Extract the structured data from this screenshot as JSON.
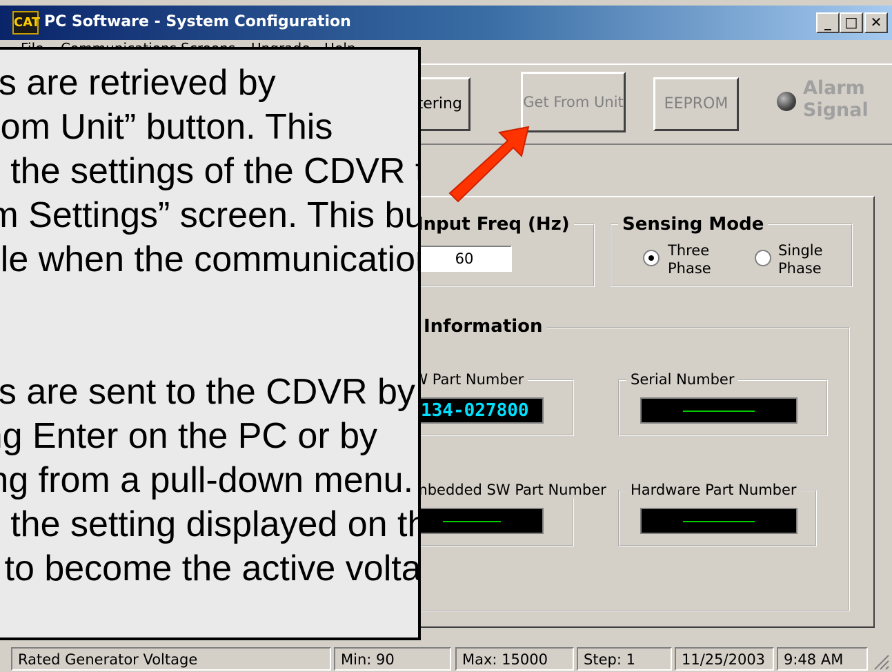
{
  "window": {
    "title": "PC Software - System Configuration",
    "app_icon_text": "CAT",
    "controls": {
      "minimize": "_",
      "maximize": "□",
      "close": "✕"
    }
  },
  "menu": {
    "items": [
      "File",
      "Communications",
      "Screens",
      "Upgrade",
      "Help"
    ]
  },
  "toolbar": {
    "metering_label": "Metering",
    "get_from_unit_label": "Get From Unit",
    "eeprom_label": "EEPROM",
    "alarm_label_1": "Alarm",
    "alarm_label_2": "Signal"
  },
  "config": {
    "input_freq": {
      "label": "Input Freq (Hz)",
      "value": "60"
    },
    "sensing_mode": {
      "label": "Sensing Mode",
      "options": [
        {
          "line1": "Three",
          "line2": "Phase",
          "selected": true
        },
        {
          "line1": "Single",
          "line2": "Phase",
          "selected": false
        }
      ]
    },
    "information": {
      "label": "Information",
      "sw_part_number": {
        "label": "SW Part Number",
        "value": "134-027800"
      },
      "serial_number": {
        "label": "Serial Number",
        "value": ""
      },
      "embedded_sw_part_number": {
        "label": "Embedded SW Part Number",
        "value": ""
      },
      "hardware_part_number": {
        "label": "Hardware Part Number",
        "value": ""
      }
    }
  },
  "status": {
    "parameter": "Rated Generator Voltage",
    "min": "Min: 90",
    "max": "Max: 15000",
    "step": "Step: 1",
    "date": "11/25/2003",
    "time": "9:48 AM"
  },
  "overlay": {
    "lines_1": [
      "Settings are retrieved by",
      "“Get From Unit” button. This",
      "causes the settings of the CDVR to be",
      "“System Settings” screen. This button",
      "available when the communication is"
    ],
    "lines_2": [
      "Settings are sent to the CDVR by",
      "pressing Enter on the PC or by",
      "selecting from a pull-down menu. This",
      "causes the setting displayed on the",
      "screen to become the active voltage"
    ]
  },
  "colors": {
    "arrow": "#ff3300",
    "title_bar": "#0a246a",
    "lcd_text": "#00e0ff",
    "lcd_line": "#00cc00"
  }
}
